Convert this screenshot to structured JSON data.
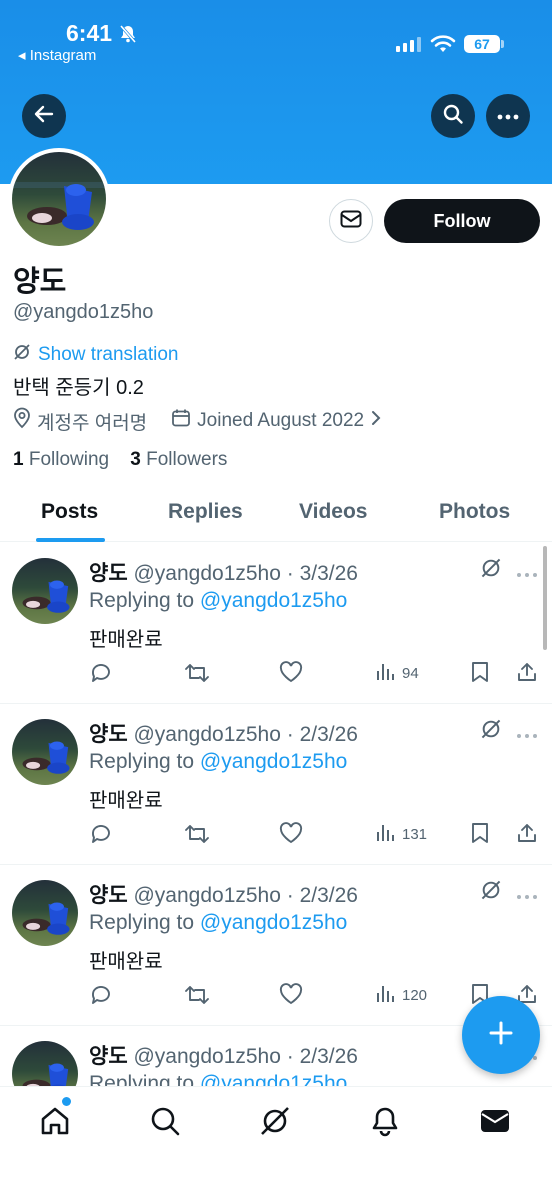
{
  "status_bar": {
    "time": "6:41",
    "back_app": "◂ Instagram",
    "battery": "67"
  },
  "profile": {
    "name": "양도",
    "handle": "@yangdo1z5ho",
    "show_translation": "Show translation",
    "bio": "반택 준등기 0.2",
    "location": "계정주 여러명",
    "joined": "Joined August 2022",
    "following_count": "1",
    "following_label": "Following",
    "followers_count": "3",
    "followers_label": "Followers",
    "follow_label": "Follow"
  },
  "tabs": [
    {
      "label": "Posts"
    },
    {
      "label": "Replies"
    },
    {
      "label": "Videos"
    },
    {
      "label": "Photos"
    }
  ],
  "posts": [
    {
      "name": "양도",
      "meta": "@yangdo1z5ho · 3/3/26",
      "replying_prefix": "Replying to ",
      "replying_handle": "@yangdo1z5ho",
      "text": "판매완료",
      "views": "94"
    },
    {
      "name": "양도",
      "meta": "@yangdo1z5ho · 2/3/26",
      "replying_prefix": "Replying to ",
      "replying_handle": "@yangdo1z5ho",
      "text": "판매완료",
      "views": "131"
    },
    {
      "name": "양도",
      "meta": "@yangdo1z5ho · 2/3/26",
      "replying_prefix": "Replying to ",
      "replying_handle": "@yangdo1z5ho",
      "text": "판매완료",
      "views": "120"
    },
    {
      "name": "양도",
      "meta": "@yangdo1z5ho · 2/3/26",
      "replying_prefix": "Replying to ",
      "replying_handle": "@yangdo1z5ho",
      "text": "",
      "views": ""
    }
  ],
  "colors": {
    "accent": "#1d9bf0",
    "text": "#0f1419",
    "secondary": "#536471",
    "follow_bg": "#0f1419"
  },
  "icons": {
    "back": "arrow-left-icon",
    "search": "search-icon",
    "more": "more-icon",
    "message": "envelope-icon",
    "translate": "grok-icon",
    "location": "location-pin-icon",
    "calendar": "calendar-icon",
    "reply": "reply-icon",
    "retweet": "retweet-icon",
    "like": "heart-icon",
    "views": "views-icon",
    "bookmark": "bookmark-icon",
    "share": "share-icon",
    "compose": "plus-icon",
    "nav": [
      "home-icon",
      "search-icon",
      "grok-icon",
      "bell-icon",
      "mail-icon"
    ]
  }
}
